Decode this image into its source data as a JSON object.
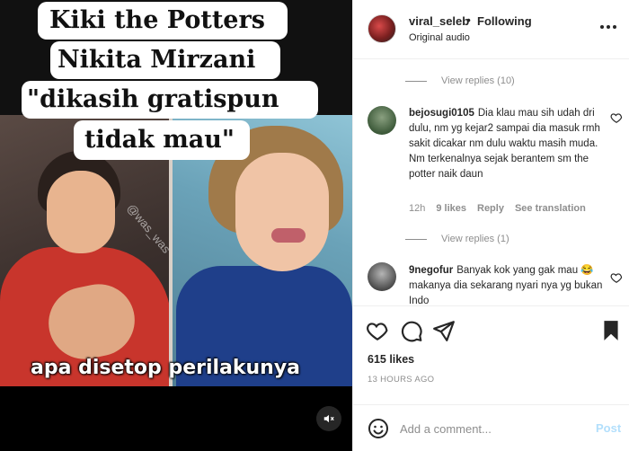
{
  "media": {
    "caption_lines": [
      "Kiki the Potters",
      "Nikita Mirzani",
      "\"dikasih gratispun",
      "tidak mau\""
    ],
    "subtitle": "apa disetop perilakunya",
    "watermark": "@was_was",
    "mute_icon": "speaker-muted-icon"
  },
  "post": {
    "author": "viral_seleb",
    "separator": "•",
    "follow_status": "Following",
    "audio": "Original audio"
  },
  "comments": {
    "view_replies_1": "View replies (10)",
    "view_replies_2": "View replies (1)",
    "items": [
      {
        "user": "bejosugi0105",
        "text": "Dia klau mau sih udah dri dulu, nm yg kejar2 sampai dia masuk rmh sakit dicakar nm dulu waktu masih muda. Nm terkenalnya sejak berantem sm the potter naik daun",
        "time": "12h",
        "likes": "9 likes",
        "reply": "Reply",
        "translate": "See translation"
      },
      {
        "user": "9negofur",
        "text": "Banyak kok yang gak mau 😂 makanya dia sekarang nyari nya yg bukan Indo"
      }
    ]
  },
  "actions": {
    "likes": "615 likes",
    "time": "13 HOURS AGO"
  },
  "add_comment": {
    "placeholder": "Add a comment...",
    "post_label": "Post"
  },
  "colors": {
    "link_blue_disabled": "#b2dffc",
    "muted_text": "#8e8e8e",
    "primary_text": "#262626"
  }
}
